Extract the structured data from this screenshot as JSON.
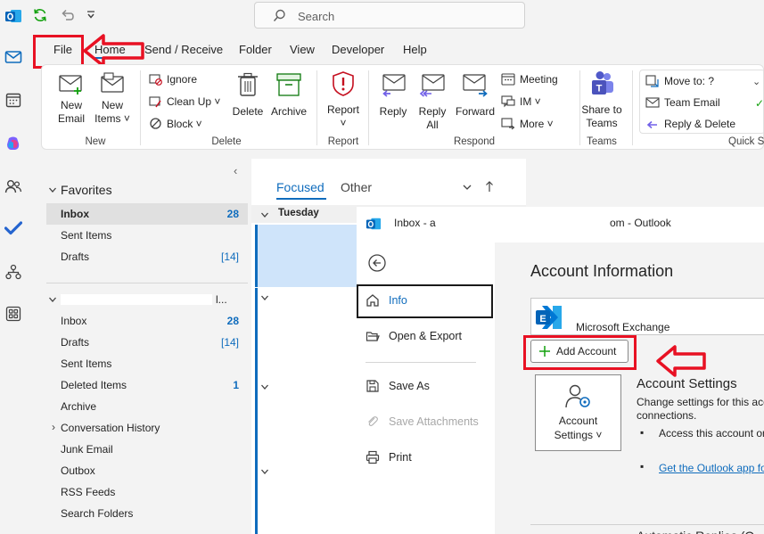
{
  "titlebar": {
    "search_placeholder": "Search"
  },
  "menu": {
    "tabs": [
      "File",
      "Home",
      "Send / Receive",
      "Folder",
      "View",
      "Developer",
      "Help"
    ]
  },
  "ribbon": {
    "new_group": {
      "new_email": [
        "New",
        "Email"
      ],
      "new_items": [
        "New",
        "Items ˅"
      ],
      "label": "New"
    },
    "delete_group": {
      "ignore": "Ignore",
      "clean_up": "Clean Up ˅",
      "block": "Block ˅",
      "delete": "Delete",
      "archive": "Archive",
      "label": "Delete"
    },
    "report_group": {
      "report": [
        "Report",
        "˅"
      ],
      "label": "Report"
    },
    "respond_group": {
      "reply": "Reply",
      "reply_all": [
        "Reply",
        "All"
      ],
      "forward": "Forward",
      "meeting": "Meeting",
      "im": "IM ˅",
      "more": "More ˅",
      "label": "Respond"
    },
    "teams_group": {
      "share_to_teams": [
        "Share to",
        "Teams"
      ],
      "label": "Teams"
    },
    "quick_steps_group": {
      "move_to": "Move to: ?",
      "team_email": "Team Email",
      "reply_delete": "Reply & Delete",
      "label": "Quick S"
    }
  },
  "favorites": {
    "header": "Favorites",
    "items": [
      {
        "label": "Inbox",
        "count": "28"
      },
      {
        "label": "Sent Items",
        "count": ""
      },
      {
        "label": "Drafts",
        "count": "[14]"
      }
    ]
  },
  "account_folders": {
    "header_suffix": "l...",
    "items": [
      {
        "label": "Inbox",
        "count": "28"
      },
      {
        "label": "Drafts",
        "count": "[14]"
      },
      {
        "label": "Sent Items",
        "count": ""
      },
      {
        "label": "Deleted Items",
        "count": "1"
      },
      {
        "label": "Archive",
        "count": ""
      },
      {
        "label": "Conversation History",
        "count": ""
      },
      {
        "label": "Junk Email",
        "count": ""
      },
      {
        "label": "Outbox",
        "count": ""
      },
      {
        "label": "RSS Feeds",
        "count": ""
      },
      {
        "label": "Search Folders",
        "count": ""
      }
    ]
  },
  "message_list": {
    "tab_focused": "Focused",
    "tab_other": "Other",
    "group_header": "Tuesday"
  },
  "backstage": {
    "window_title_prefix": "Inbox - a",
    "window_title_suffix": "om  -  Outlook",
    "nav": {
      "info": "Info",
      "open_export": "Open & Export",
      "save_as": "Save As",
      "save_attachments": "Save Attachments",
      "print": "Print"
    },
    "main": {
      "title": "Account Information",
      "account_type": "Microsoft Exchange",
      "add_account": "Add Account",
      "account_settings_button": [
        "Account",
        "Settings ˅"
      ],
      "account_settings_heading": "Account Settings",
      "account_settings_desc_1": "Change settings for this acco",
      "account_settings_desc_2": "connections.",
      "bullet_1": "Access this account on",
      "link_1": "Get the Outlook app fo",
      "bottom_cut": "Automatic Replies (O"
    }
  },
  "colors": {
    "accent": "#0f6cbd",
    "annotation_red": "#e81123",
    "info_bar": "#1a1a1a"
  }
}
